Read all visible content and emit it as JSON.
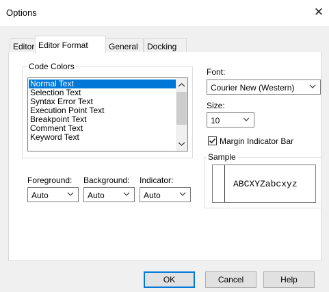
{
  "window": {
    "title": "Options"
  },
  "tabs": [
    {
      "label": "Editor"
    },
    {
      "label": "Editor Format"
    },
    {
      "label": "General"
    },
    {
      "label": "Docking"
    }
  ],
  "code_colors": {
    "group_label": "Code Colors",
    "items": [
      "Normal Text",
      "Selection Text",
      "Syntax Error Text",
      "Execution Point Text",
      "Breakpoint Text",
      "Comment Text",
      "Keyword Text"
    ],
    "selected_item": "Normal Text"
  },
  "color_pickers": {
    "foreground": {
      "label": "Foreground:",
      "value": "Auto"
    },
    "background": {
      "label": "Background:",
      "value": "Auto"
    },
    "indicator": {
      "label": "Indicator:",
      "value": "Auto"
    }
  },
  "font": {
    "label": "Font:",
    "value": "Courier New (Western)"
  },
  "size": {
    "label": "Size:",
    "value": "10"
  },
  "margin_indicator": {
    "label": "Margin Indicator Bar",
    "checked": true
  },
  "sample": {
    "label": "Sample",
    "text": "ABCXYZabcxyz"
  },
  "buttons": {
    "ok": "OK",
    "cancel": "Cancel",
    "help": "Help"
  },
  "colors": {
    "selection": "#0078d7",
    "default_button_border": "#0078d7"
  }
}
